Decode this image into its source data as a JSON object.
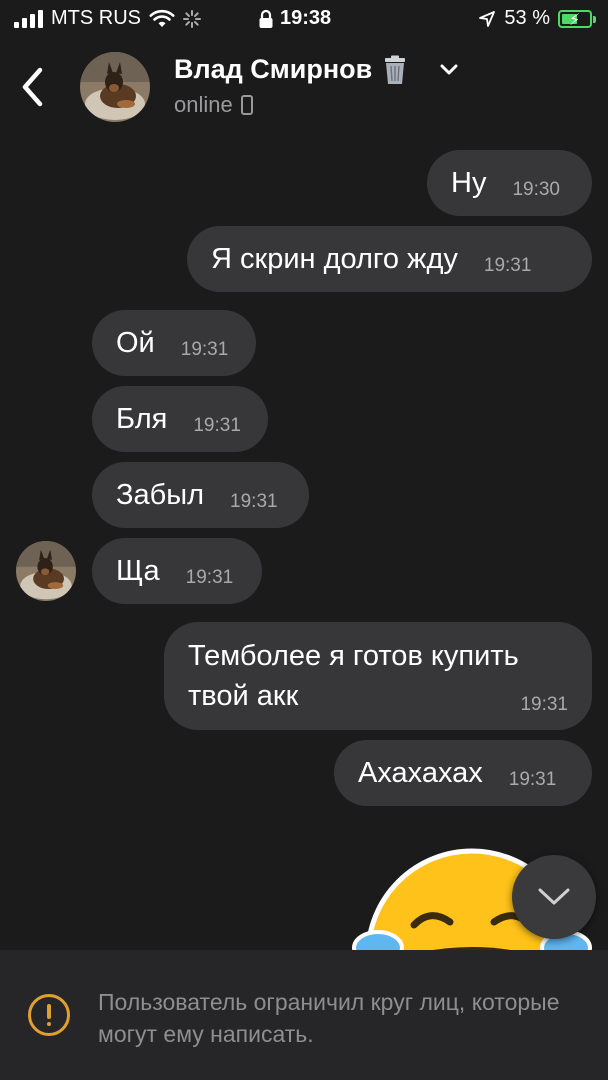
{
  "status_bar": {
    "carrier": "MTS RUS",
    "time": "19:38",
    "battery_percent": "53 %",
    "battery_level": 0.53,
    "icons": [
      "signal-icon",
      "wifi-icon",
      "loading-icon",
      "lock-icon",
      "location-icon",
      "battery-icon"
    ]
  },
  "header": {
    "contact_name": "Влад Смирнов",
    "status": "online",
    "icons": [
      "back-chevron-icon",
      "trash-icon",
      "chevron-down-icon",
      "phone-icon"
    ]
  },
  "messages": [
    {
      "direction": "out",
      "text": "Ну",
      "time": "19:30"
    },
    {
      "direction": "out",
      "text": "Я скрин долго жду",
      "time": "19:31"
    },
    {
      "direction": "in",
      "text": "Ой",
      "time": "19:31"
    },
    {
      "direction": "in",
      "text": "Бля",
      "time": "19:31"
    },
    {
      "direction": "in",
      "text": "Забыл",
      "time": "19:31"
    },
    {
      "direction": "in",
      "text": "Ща",
      "time": "19:31"
    },
    {
      "direction": "out",
      "text": "Темболее я готов купить твой акк",
      "time": "19:31"
    },
    {
      "direction": "out",
      "text": "Ахахахах",
      "time": "19:31"
    }
  ],
  "sticker": {
    "icon": "laughing-emoji-sticker"
  },
  "footer": {
    "notice": "Пользователь ограничил круг лиц, которые могут ему написать.",
    "icon": "warning-icon",
    "accent_color": "#e0a030"
  },
  "colors": {
    "background": "#1b1b1c",
    "bubble": "#373739",
    "footer": "#262628",
    "battery": "#4cd964"
  }
}
